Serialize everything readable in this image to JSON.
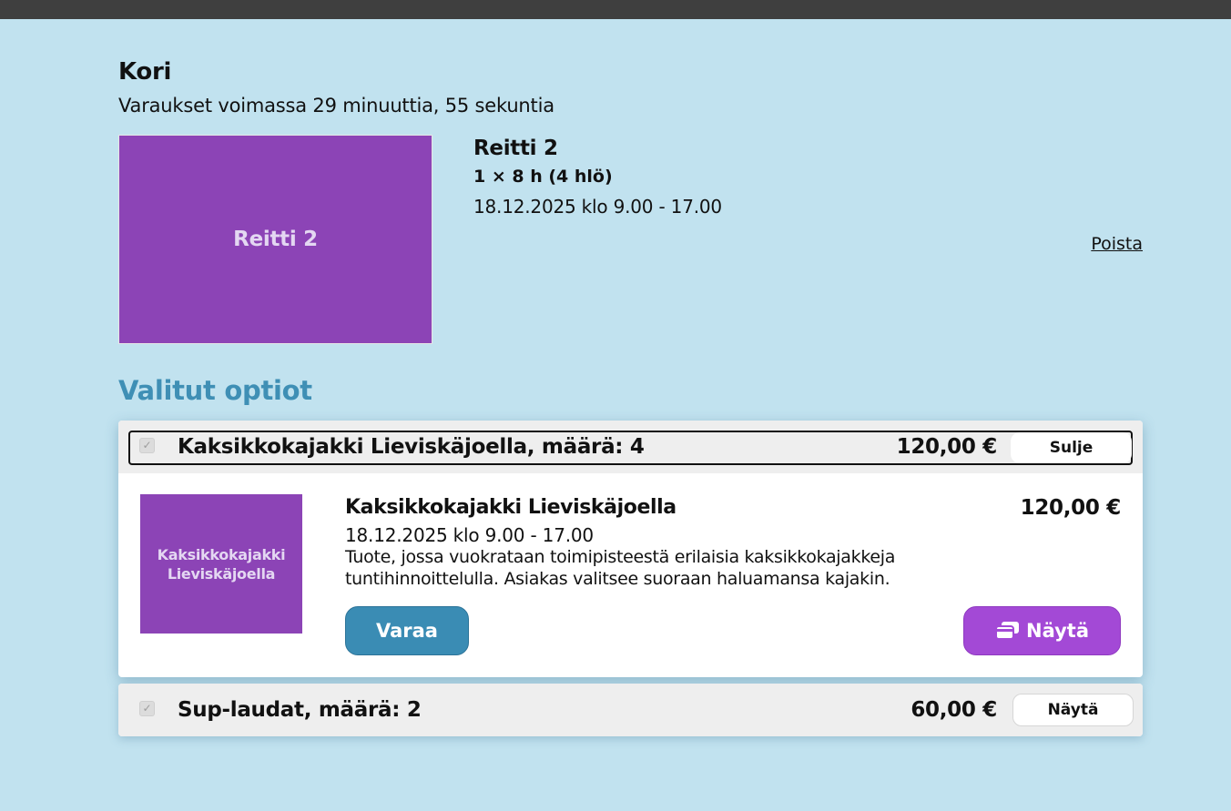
{
  "cart": {
    "title": "Kori",
    "timer_text": "Varaukset voimassa 29 minuuttia, 55 sekuntia"
  },
  "reservation": {
    "image_label": "Reitti 2",
    "name": "Reitti 2",
    "quantity": "1 × 8 h (4 hlö)",
    "datetime": "18.12.2025 klo 9.00 - 17.00",
    "remove_label": "Poista"
  },
  "options": {
    "title": "Valitut optiot",
    "items": [
      {
        "label": "Kaksikkokajakki Lieviskäjoella, määrä: 4",
        "price": "120,00 €",
        "toggle_label": "Sulje",
        "checked": true,
        "expanded": true,
        "product": {
          "image_label_line1": "Kaksikkokajakki",
          "image_label_line2": "Lieviskäjoella",
          "name": "Kaksikkokajakki Lieviskäjoella",
          "price": "120,00 €",
          "datetime": "18.12.2025 klo 9.00 - 17.00",
          "description": "Tuote, jossa vuokrataan toimipisteestä erilaisia kaksikkokajakkeja tuntihinnoittelulla. Asiakas valitsee suoraan haluamansa kajakin.",
          "book_label": "Varaa",
          "show_label": "Näytä",
          "show_icon": "cards-icon"
        }
      },
      {
        "label": "Sup-laudat, määrä: 2",
        "price": "60,00 €",
        "toggle_label": "Näytä",
        "checked": true,
        "expanded": false
      }
    ]
  },
  "colors": {
    "background": "#c1e2ef",
    "topbar": "#3f3f3f",
    "product_image": "#8c44b6",
    "accent_blue": "#3a8cb4",
    "accent_purple": "#a349d6",
    "options_title": "#3f8fb5"
  }
}
